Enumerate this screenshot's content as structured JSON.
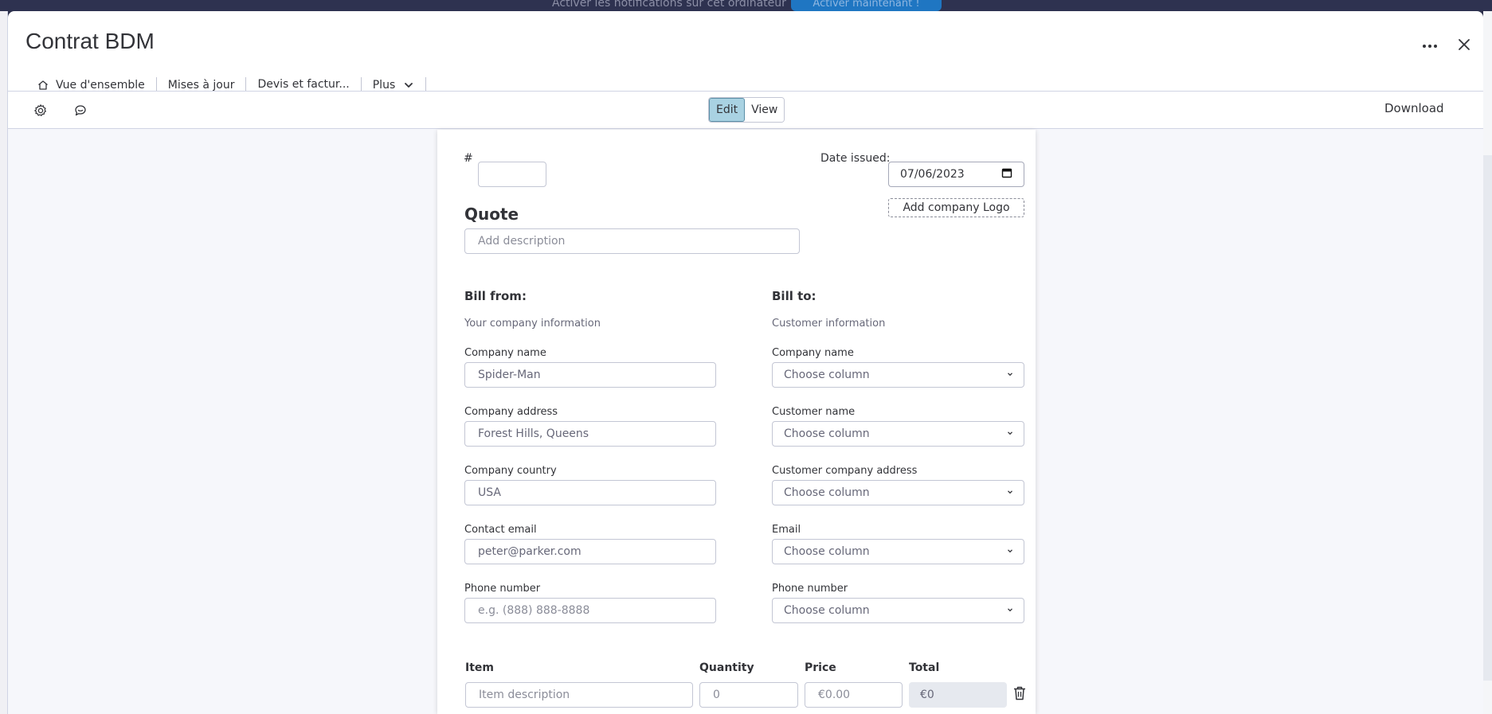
{
  "background": {
    "notification_text": "Activer les notifications sur cet ordinateur",
    "notification_button": "Activer maintenant !"
  },
  "header": {
    "title": "Contrat BDM",
    "more_icon": "more-horizontal-icon",
    "close_icon": "close-icon"
  },
  "tabs": [
    {
      "label": "Vue d'ensemble",
      "icon": "home-icon"
    },
    {
      "label": "Mises à jour"
    },
    {
      "label": "Devis et factur...",
      "active": true
    },
    {
      "label": "Plus",
      "icon": "chevron-down-icon"
    }
  ],
  "toolbar": {
    "settings_icon": "gear-icon",
    "feedback_icon": "chat-bubble-icon",
    "edit_label": "Edit",
    "view_label": "View",
    "download_label": "Download"
  },
  "document": {
    "number_label": "#",
    "number_value": "",
    "date_label": "Date issued:",
    "date_value": "07/06/2023",
    "logo_button": "Add company Logo",
    "heading": "Quote",
    "description_placeholder": "Add description",
    "bill_from": {
      "heading": "Bill from:",
      "subtitle": "Your company information",
      "fields": [
        {
          "label": "Company name",
          "value": "Spider-Man"
        },
        {
          "label": "Company address",
          "value": " Forest Hills, Queens"
        },
        {
          "label": "Company country",
          "value": "USA"
        },
        {
          "label": "Contact email",
          "value": "peter@parker.com"
        },
        {
          "label": "Phone number",
          "placeholder": "e.g. (888) 888-8888"
        }
      ]
    },
    "bill_to": {
      "heading": "Bill to:",
      "subtitle": "Customer information",
      "fields": [
        {
          "label": "Company name",
          "value": "Choose column"
        },
        {
          "label": "Customer name",
          "value": "Choose column"
        },
        {
          "label": "Customer company address",
          "value": "Choose column"
        },
        {
          "label": "Email",
          "value": "Choose column"
        },
        {
          "label": "Phone number",
          "value": "Choose column"
        }
      ]
    },
    "items": {
      "headers": {
        "item": "Item",
        "quantity": "Quantity",
        "price": "Price",
        "total": "Total"
      },
      "row": {
        "item_placeholder": "Item description",
        "quantity_placeholder": "0",
        "price_placeholder": "€0.00",
        "total": "€0",
        "delete_icon": "trash-icon"
      }
    }
  }
}
